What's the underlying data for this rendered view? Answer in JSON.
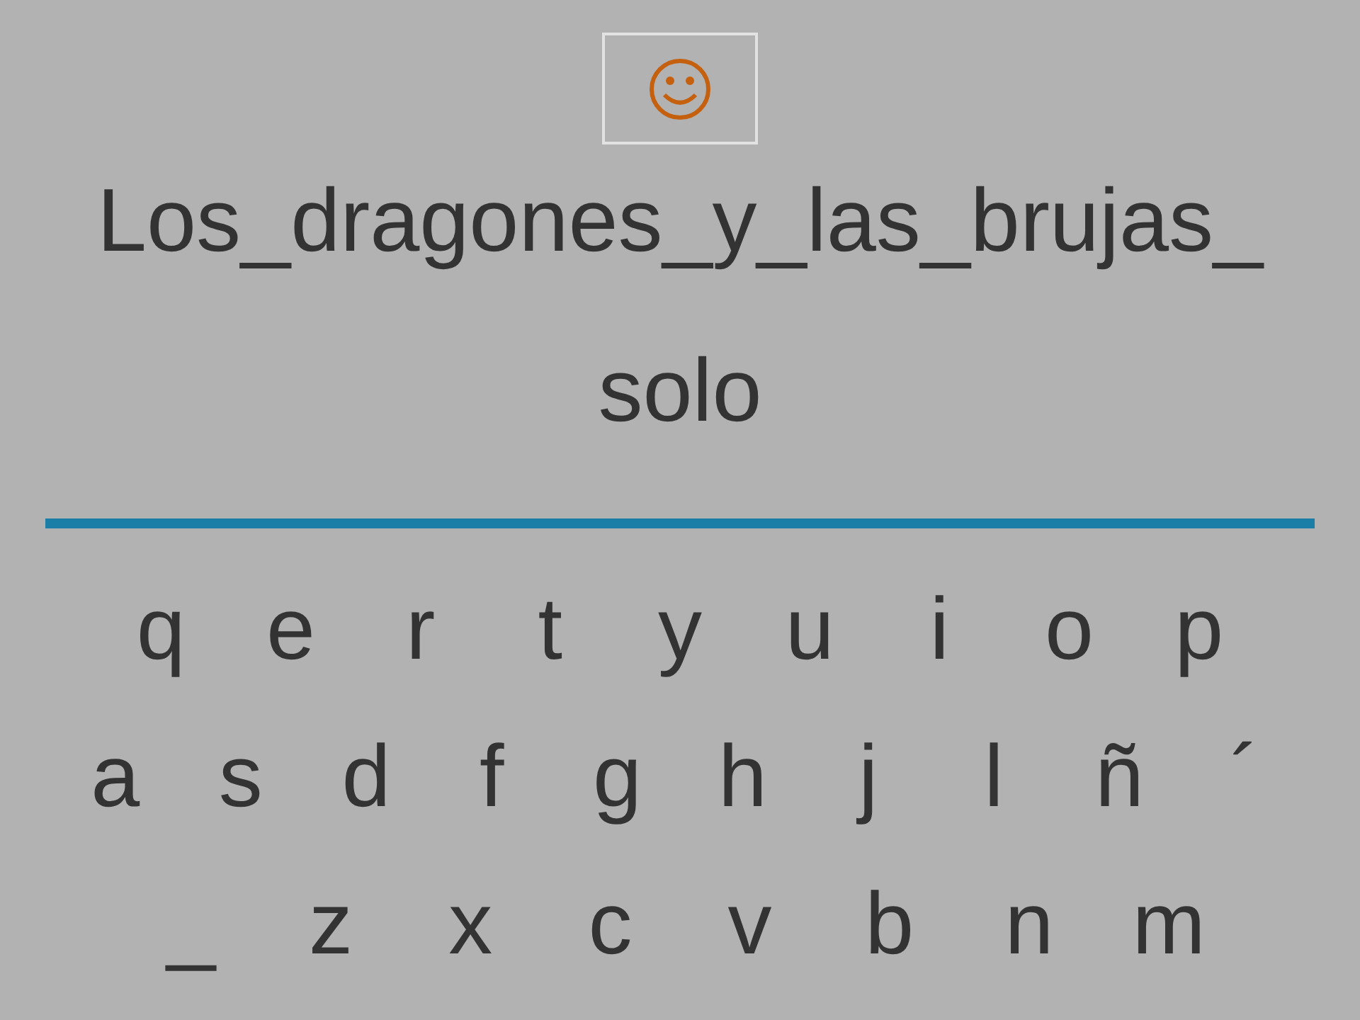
{
  "prompt": {
    "lines": [
      "Los_dragones_y_las_brujas_",
      "solo"
    ]
  },
  "keyboard": {
    "rows": [
      [
        "q",
        "e",
        "r",
        "t",
        "y",
        "u",
        "i",
        "o",
        "p"
      ],
      [
        "a",
        "s",
        "d",
        "f",
        "g",
        "h",
        "j",
        "l",
        "ñ",
        "´"
      ],
      [
        "_",
        "z",
        "x",
        "c",
        "v",
        "b",
        "n",
        "m"
      ]
    ]
  }
}
